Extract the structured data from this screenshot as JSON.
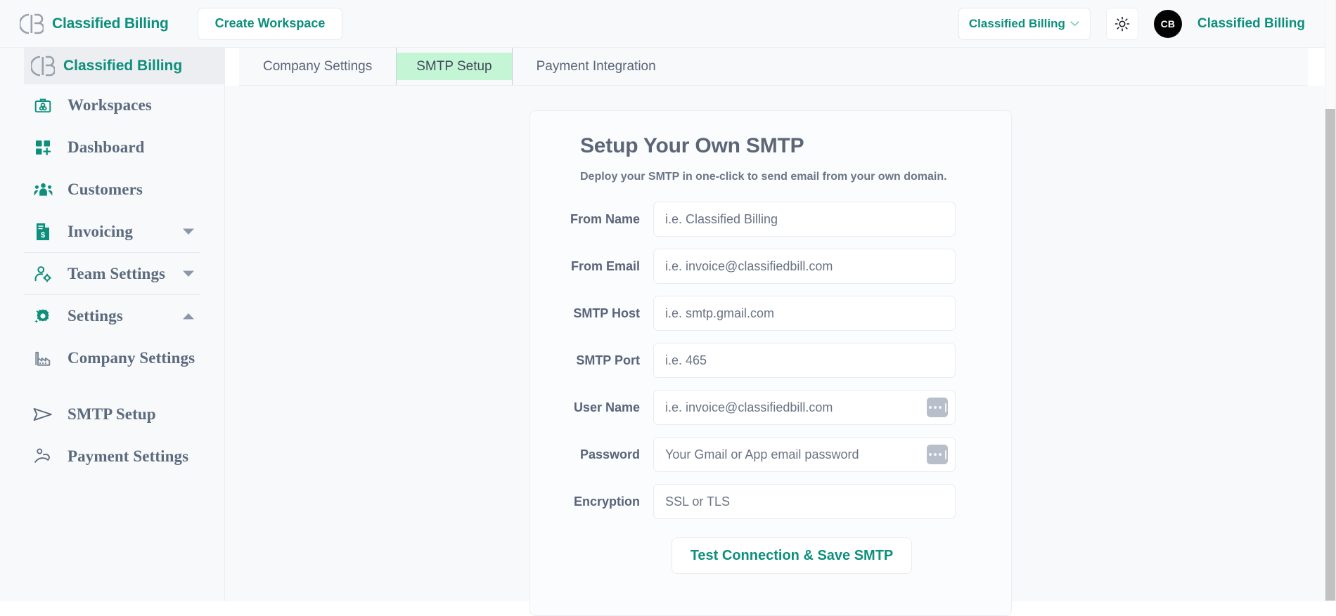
{
  "topbar": {
    "logo_icon": "cb-logo-icon",
    "brand": "Classified Billing",
    "create_workspace": "Create Workspace",
    "workspace_select": {
      "value": "Classified Billing",
      "caret_icon": "chevron-down-icon"
    },
    "theme_toggle_icon": "sun-icon",
    "avatar_initials": "CB",
    "user_name": "Classified Billing"
  },
  "sidebar": {
    "header": {
      "logo_icon": "cb-logo-icon",
      "label": "Classified Billing"
    },
    "items": [
      {
        "label": "Workspaces",
        "icon": "briefcase-icon",
        "caret": "",
        "divider": false
      },
      {
        "label": "Dashboard",
        "icon": "dashboard-grid-icon",
        "caret": "",
        "divider": false
      },
      {
        "label": "Customers",
        "icon": "users-icon",
        "caret": "",
        "divider": false
      },
      {
        "label": "Invoicing",
        "icon": "invoice-doc-icon",
        "caret": "chevron-down-icon",
        "divider": true
      },
      {
        "label": "Team Settings",
        "icon": "user-gear-icon",
        "caret": "chevron-down-icon",
        "divider": true
      },
      {
        "label": "Settings",
        "icon": "gear-icon",
        "caret": "chevron-up-icon",
        "divider": false
      },
      {
        "label": "Company Settings",
        "icon": "factory-icon",
        "caret": "",
        "divider": false
      },
      {
        "label": "SMTP Setup",
        "icon": "paper-plane-icon",
        "caret": "",
        "divider": false
      },
      {
        "label": "Payment Settings",
        "icon": "hand-coin-icon",
        "caret": "",
        "divider": false
      }
    ]
  },
  "tabs": [
    {
      "label": "Company Settings",
      "active": false
    },
    {
      "label": "SMTP Setup",
      "active": true
    },
    {
      "label": "Payment Integration",
      "active": false
    }
  ],
  "card": {
    "title": "Setup Your Own SMTP",
    "subtitle": "Deploy your SMTP in one-click to send email from your own domain.",
    "fields": [
      {
        "label": "From Name",
        "placeholder": "i.e. Classified Billing",
        "value": "",
        "trailing_icon": ""
      },
      {
        "label": "From Email",
        "placeholder": "i.e. invoice@classifiedbill.com",
        "value": "",
        "trailing_icon": ""
      },
      {
        "label": "SMTP Host",
        "placeholder": "i.e. smtp.gmail.com",
        "value": "",
        "trailing_icon": ""
      },
      {
        "label": "SMTP Port",
        "placeholder": "i.e. 465",
        "value": "",
        "trailing_icon": ""
      },
      {
        "label": "User Name",
        "placeholder": "i.e. invoice@classifiedbill.com",
        "value": "",
        "trailing_icon": "password-manager-icon"
      },
      {
        "label": "Password",
        "placeholder": "Your Gmail or App email password",
        "value": "",
        "trailing_icon": "password-manager-icon"
      },
      {
        "label": "Encryption",
        "placeholder": "SSL or TLS",
        "value": "",
        "trailing_icon": ""
      }
    ],
    "submit_label": "Test Connection & Save SMTP"
  },
  "colors": {
    "accent_teal": "#0d8f7c",
    "active_tab_bg": "#c4f6d6",
    "surface": "#f8f9fb",
    "label_gray": "#59647a",
    "sidebar_label": "#5b6a7d"
  }
}
